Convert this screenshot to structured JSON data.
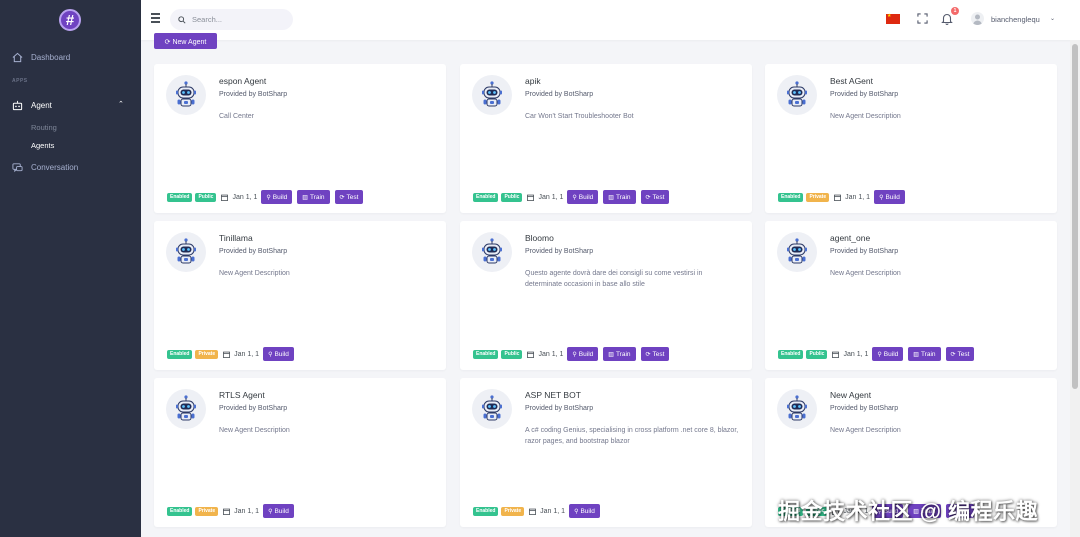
{
  "sidebar": {
    "logo_text": "#",
    "items": [
      {
        "label": "Dashboard",
        "icon": "home-icon"
      },
      {
        "label": "Agent",
        "icon": "robot-icon"
      },
      {
        "label": "Conversation",
        "icon": "chat-icon"
      }
    ],
    "section_label": "APPS",
    "sub_items": [
      {
        "label": "Routing"
      },
      {
        "label": "Agents"
      }
    ]
  },
  "topbar": {
    "search_placeholder": "Search...",
    "notification_count": "1",
    "user_name": "bianchenglequ",
    "flag_color": "#de2910"
  },
  "toolbar": {
    "new_agent_label": "⟳ New Agent"
  },
  "labels": {
    "enabled": "Enabled",
    "public": "Public",
    "private": "Private",
    "date": "Jan 1, 1",
    "build": "Build",
    "train": "Train",
    "test": "Test"
  },
  "agents": [
    {
      "name": "espon Agent",
      "provider": "Provided by BotSharp",
      "description": "Call Center"
    },
    {
      "name": "apik",
      "provider": "Provided by BotSharp",
      "description": "Car Won't Start Troubleshooter Bot"
    },
    {
      "name": "Best AGent",
      "provider": "Provided by BotSharp",
      "description": "New Agent Description"
    },
    {
      "name": "Tinillama",
      "provider": "Provided by BotSharp",
      "description": "New Agent Description"
    },
    {
      "name": "Bloomo",
      "provider": "Provided by BotSharp",
      "description": "Questo agente dovrà dare dei consigli su come vestirsi in determinate occasioni in base allo stile"
    },
    {
      "name": "agent_one",
      "provider": "Provided by BotSharp",
      "description": "New Agent Description"
    },
    {
      "name": "RTLS Agent",
      "provider": "Provided by BotSharp",
      "description": "New Agent Description"
    },
    {
      "name": "ASP NET BOT",
      "provider": "Provided by BotSharp",
      "description": "A c# coding Genius, specialising in cross platform .net core 8, blazor, razor pages, and bootstrap blazor"
    },
    {
      "name": "New Agent",
      "provider": "Provided by BotSharp",
      "description": "New Agent Description"
    }
  ],
  "watermark": "掘金技术社区 @ 编程乐趣",
  "colors": {
    "accent": "#6f42c1",
    "sidebar": "#2a3042",
    "enabled": "#34c38f",
    "private": "#f1b44c"
  }
}
